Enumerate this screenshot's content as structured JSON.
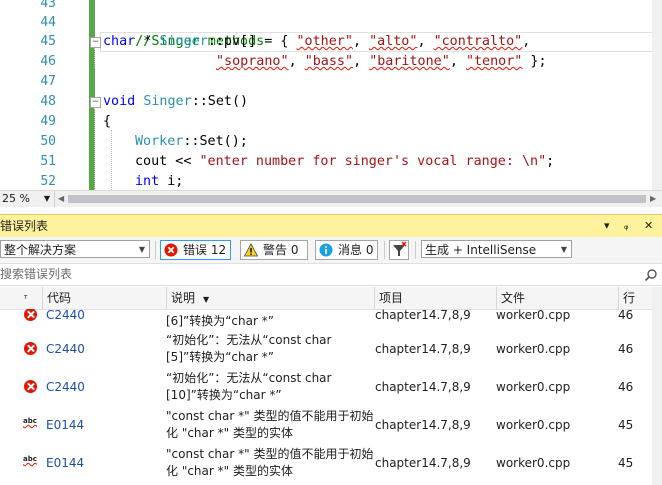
{
  "editor": {
    "line_numbers": [
      "43",
      "44",
      "45",
      "46",
      "47",
      "48",
      "49",
      "50",
      "51",
      "52"
    ],
    "comment": "//Singer methods",
    "line45": {
      "kw": "char",
      "pre": " * ",
      "cls": "Singer",
      "rest": "::pv[] = { ",
      "s1": "\"other\"",
      "c1": ", ",
      "s2": "\"alto\"",
      "c2": ", ",
      "s3": "\"contralto\"",
      "c3": ","
    },
    "line46": {
      "s1": "\"soprano\"",
      "c1": ", ",
      "s2": "\"bass\"",
      "c2": ", ",
      "s3": "\"baritone\"",
      "c3": ", ",
      "s4": "\"tenor\"",
      "end": " };"
    },
    "line48": {
      "kw": "void",
      "sp": " ",
      "cls": "Singer",
      "rest": "::Set()"
    },
    "line49": "{",
    "line50": {
      "cls": "Worker",
      "rest": "::Set();"
    },
    "line51": {
      "pre": "cout << ",
      "str": "\"enter number for singer's vocal range: \\n\"",
      "end": ";"
    },
    "line52": {
      "kw": "int",
      "rest": " i;"
    }
  },
  "zoom": "25 %",
  "panel": {
    "title": "错误列表",
    "pin_glyph": "▾",
    "pin2": "ᵩ",
    "close": "✕"
  },
  "toolbar": {
    "scope": "整个解决方案",
    "errors_label": "错误 12",
    "warnings_label": "警告 0",
    "messages_label": "消息 0",
    "build_filter": "生成 + IntelliSense"
  },
  "search": {
    "placeholder": "搜索错误列表"
  },
  "columns": {
    "code": "代码",
    "desc": "说明",
    "project": "项目",
    "file": "文件",
    "line": "行"
  },
  "rows": [
    {
      "icon": "error",
      "code": "C2440",
      "desc1": "[6]”转换为“char *”",
      "desc2": "",
      "project": "chapter14.7,8,9",
      "file": "worker0.cpp",
      "line": "46"
    },
    {
      "icon": "error",
      "code": "C2440",
      "desc1": "“初始化”：无法从“const char",
      "desc2": "[5]”转换为“char *”",
      "project": "chapter14.7,8,9",
      "file": "worker0.cpp",
      "line": "46"
    },
    {
      "icon": "error",
      "code": "C2440",
      "desc1": "“初始化”：无法从“const char",
      "desc2": "[10]”转换为“char *”",
      "project": "chapter14.7,8,9",
      "file": "worker0.cpp",
      "line": "46"
    },
    {
      "icon": "abc",
      "code": "E0144",
      "desc1": "\"const char *\" 类型的值不能用于初始",
      "desc2": "化 \"char *\" 类型的实体",
      "project": "chapter14.7,8,9",
      "file": "worker0.cpp",
      "line": "45"
    },
    {
      "icon": "abc",
      "code": "E0144",
      "desc1": "\"const char *\" 类型的值不能用于初始",
      "desc2": "化 \"char *\" 类型的实体",
      "project": "chapter14.7,8,9",
      "file": "worker0.cpp",
      "line": "45"
    }
  ],
  "icon_names": {
    "abc": "abc"
  }
}
